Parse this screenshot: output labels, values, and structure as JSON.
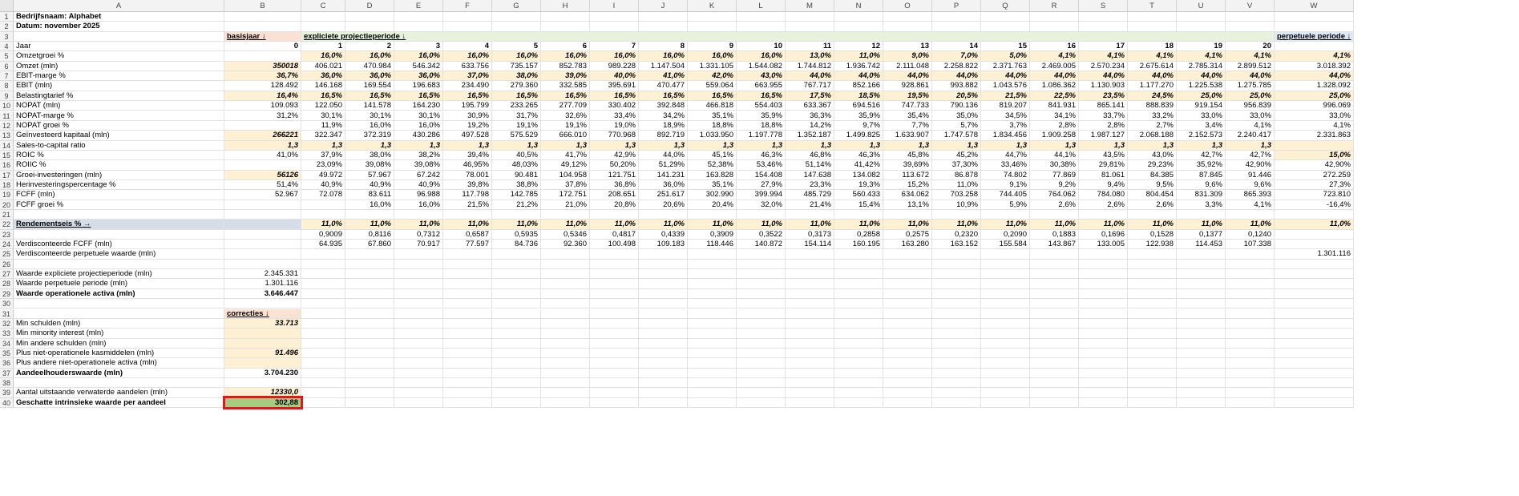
{
  "columns": [
    "A",
    "B",
    "C",
    "D",
    "E",
    "F",
    "G",
    "H",
    "I",
    "J",
    "K",
    "L",
    "M",
    "N",
    "O",
    "P",
    "Q",
    "R",
    "S",
    "T",
    "U",
    "V",
    "W"
  ],
  "row_numbers": [
    "1",
    "2",
    "3",
    "4",
    "5",
    "6",
    "7",
    "8",
    "9",
    "10",
    "11",
    "12",
    "13",
    "14",
    "15",
    "16",
    "17",
    "18",
    "19",
    "20",
    "21",
    "22",
    "23",
    "24",
    "25",
    "26",
    "27",
    "28",
    "29",
    "30",
    "31",
    "32",
    "33",
    "34",
    "35",
    "36",
    "37",
    "38",
    "39",
    "40"
  ],
  "header": {
    "company": "Bedrijfsnaam: Alphabet",
    "date": "Datum: november 2025",
    "base_year": "basisjaar ↓",
    "explicit_period": "expliciete projectieperiode ↓",
    "perpetual_period": "perpetuele periode ↓"
  },
  "rows": [
    {
      "row": 4,
      "label": "Jaar",
      "bold": false,
      "B": "0",
      "vals": [
        "1",
        "2",
        "3",
        "4",
        "5",
        "6",
        "7",
        "8",
        "9",
        "10",
        "11",
        "12",
        "13",
        "14",
        "15",
        "16",
        "17",
        "18",
        "19",
        "20"
      ],
      "W": "",
      "fmt": "b"
    },
    {
      "row": 5,
      "label": "Omzetgroei %",
      "B": "",
      "vals": [
        "16,0%",
        "16,0%",
        "16,0%",
        "16,0%",
        "16,0%",
        "16,0%",
        "16,0%",
        "16,0%",
        "16,0%",
        "16,0%",
        "13,0%",
        "11,0%",
        "9,0%",
        "7,0%",
        "5,0%",
        "4,1%",
        "4,1%",
        "4,1%",
        "4,1%",
        "4,1%"
      ],
      "W": "4,1%",
      "fmt": "yi"
    },
    {
      "row": 6,
      "label": "Omzet (mln)",
      "B": "350018",
      "vals": [
        "406.021",
        "470.984",
        "546.342",
        "633.756",
        "735.157",
        "852.783",
        "989.228",
        "1.147.504",
        "1.331.105",
        "1.544.082",
        "1.744.812",
        "1.936.742",
        "2.111.048",
        "2.258.822",
        "2.371.763",
        "2.469.005",
        "2.570.234",
        "2.675.614",
        "2.785.314",
        "2.899.512"
      ],
      "W": "3.018.392",
      "fmt": "n",
      "Bfmt": "yi"
    },
    {
      "row": 7,
      "label": "EBIT-marge %",
      "B": "36,7%",
      "vals": [
        "36,0%",
        "36,0%",
        "36,0%",
        "37,0%",
        "38,0%",
        "39,0%",
        "40,0%",
        "41,0%",
        "42,0%",
        "43,0%",
        "44,0%",
        "44,0%",
        "44,0%",
        "44,0%",
        "44,0%",
        "44,0%",
        "44,0%",
        "44,0%",
        "44,0%",
        "44,0%"
      ],
      "W": "44,0%",
      "fmt": "yi",
      "Bfmt": "yi"
    },
    {
      "row": 8,
      "label": "EBIT (mln)",
      "B": "128.492",
      "vals": [
        "146.168",
        "169.554",
        "196.683",
        "234.490",
        "279.360",
        "332.585",
        "395.691",
        "470.477",
        "559.064",
        "663.955",
        "767.717",
        "852.166",
        "928.861",
        "993.882",
        "1.043.576",
        "1.086.362",
        "1.130.903",
        "1.177.270",
        "1.225.538",
        "1.275.785"
      ],
      "W": "1.328.092",
      "fmt": "n"
    },
    {
      "row": 9,
      "label": "Belastingtarief %",
      "B": "16,4%",
      "vals": [
        "16,5%",
        "16,5%",
        "16,5%",
        "16,5%",
        "16,5%",
        "16,5%",
        "16,5%",
        "16,5%",
        "16,5%",
        "16,5%",
        "17,5%",
        "18,5%",
        "19,5%",
        "20,5%",
        "21,5%",
        "22,5%",
        "23,5%",
        "24,5%",
        "25,0%",
        "25,0%"
      ],
      "W": "25,0%",
      "fmt": "yi",
      "Bfmt": "yi"
    },
    {
      "row": 10,
      "label": "NOPAT (mln)",
      "B": "109.093",
      "vals": [
        "122.050",
        "141.578",
        "164.230",
        "195.799",
        "233.265",
        "277.709",
        "330.402",
        "392.848",
        "466.818",
        "554.403",
        "633.367",
        "694.516",
        "747.733",
        "790.136",
        "819.207",
        "841.931",
        "865.141",
        "888.839",
        "919.154",
        "956.839"
      ],
      "W": "996.069",
      "fmt": "n"
    },
    {
      "row": 11,
      "label": "NOPAT-marge %",
      "B": "31,2%",
      "vals": [
        "30,1%",
        "30,1%",
        "30,1%",
        "30,9%",
        "31,7%",
        "32,6%",
        "33,4%",
        "34,2%",
        "35,1%",
        "35,9%",
        "36,3%",
        "35,9%",
        "35,4%",
        "35,0%",
        "34,5%",
        "34,1%",
        "33,7%",
        "33,2%",
        "33,0%",
        "33,0%"
      ],
      "W": "33,0%",
      "fmt": "n"
    },
    {
      "row": 12,
      "label": "NOPAT groei %",
      "B": "",
      "vals": [
        "11,9%",
        "16,0%",
        "16,0%",
        "19,2%",
        "19,1%",
        "19,1%",
        "19,0%",
        "18,9%",
        "18,8%",
        "18,8%",
        "14,2%",
        "9,7%",
        "7,7%",
        "5,7%",
        "3,7%",
        "2,8%",
        "2,8%",
        "2,7%",
        "3,4%",
        "4,1%"
      ],
      "W": "4,1%",
      "fmt": "n"
    },
    {
      "row": 13,
      "label": "Geïnvesteerd kapitaal (mln)",
      "B": "266221",
      "vals": [
        "322.347",
        "372.319",
        "430.286",
        "497.528",
        "575.529",
        "666.010",
        "770.968",
        "892.719",
        "1.033.950",
        "1.197.778",
        "1.352.187",
        "1.499.825",
        "1.633.907",
        "1.747.578",
        "1.834.456",
        "1.909.258",
        "1.987.127",
        "2.068.188",
        "2.152.573",
        "2.240.417"
      ],
      "W": "2.331.863",
      "fmt": "n",
      "Bfmt": "yi"
    },
    {
      "row": 14,
      "label": "Sales-to-capital ratio",
      "B": "1,3",
      "vals": [
        "1,3",
        "1,3",
        "1,3",
        "1,3",
        "1,3",
        "1,3",
        "1,3",
        "1,3",
        "1,3",
        "1,3",
        "1,3",
        "1,3",
        "1,3",
        "1,3",
        "1,3",
        "1,3",
        "1,3",
        "1,3",
        "1,3",
        "1,3"
      ],
      "W": "",
      "fmt": "yi",
      "Bfmt": "yi"
    },
    {
      "row": 15,
      "label": "ROIC %",
      "B": "41,0%",
      "vals": [
        "37,9%",
        "38,0%",
        "38,2%",
        "39,4%",
        "40,5%",
        "41,7%",
        "42,9%",
        "44,0%",
        "45,1%",
        "46,3%",
        "46,8%",
        "46,3%",
        "45,8%",
        "45,2%",
        "44,7%",
        "44,1%",
        "43,5%",
        "43,0%",
        "42,7%",
        "42,7%"
      ],
      "W": "15,0%",
      "fmt": "n",
      "Wfmt": "yi"
    },
    {
      "row": 16,
      "label": "ROIIC %",
      "B": "",
      "vals": [
        "23,09%",
        "39,08%",
        "39,08%",
        "46,95%",
        "48,03%",
        "49,12%",
        "50,20%",
        "51,29%",
        "52,38%",
        "53,46%",
        "51,14%",
        "41,42%",
        "39,69%",
        "37,30%",
        "33,46%",
        "30,38%",
        "29,81%",
        "29,23%",
        "35,92%",
        "42,90%"
      ],
      "W": "42,90%",
      "fmt": "n"
    },
    {
      "row": 17,
      "label": "Groei-investeringen (mln)",
      "B": "56126",
      "vals": [
        "49.972",
        "57.967",
        "67.242",
        "78.001",
        "90.481",
        "104.958",
        "121.751",
        "141.231",
        "163.828",
        "154.408",
        "147.638",
        "134.082",
        "113.672",
        "86.878",
        "74.802",
        "77.869",
        "81.061",
        "84.385",
        "87.845",
        "91.446"
      ],
      "W": "272.259",
      "fmt": "n",
      "Bfmt": "yi"
    },
    {
      "row": 18,
      "label": "Herinvesteringspercentage %",
      "B": "51,4%",
      "vals": [
        "40,9%",
        "40,9%",
        "40,9%",
        "39,8%",
        "38,8%",
        "37,8%",
        "36,8%",
        "36,0%",
        "35,1%",
        "27,9%",
        "23,3%",
        "19,3%",
        "15,2%",
        "11,0%",
        "9,1%",
        "9,2%",
        "9,4%",
        "9,5%",
        "9,6%",
        "9,6%"
      ],
      "W": "27,3%",
      "fmt": "n"
    },
    {
      "row": 19,
      "label": "FCFF (mln)",
      "B": "52.967",
      "vals": [
        "72.078",
        "83.611",
        "96.988",
        "117.798",
        "142.785",
        "172.751",
        "208.651",
        "251.617",
        "302.990",
        "399.994",
        "485.729",
        "560.433",
        "634.062",
        "703.258",
        "744.405",
        "764.062",
        "784.080",
        "804.454",
        "831.309",
        "865.393"
      ],
      "W": "723.810",
      "fmt": "n"
    },
    {
      "row": 20,
      "label": "FCFF groei %",
      "B": "",
      "vals": [
        "",
        "16,0%",
        "16,0%",
        "21,5%",
        "21,2%",
        "21,0%",
        "20,8%",
        "20,6%",
        "20,4%",
        "32,0%",
        "21,4%",
        "15,4%",
        "13,1%",
        "10,9%",
        "5,9%",
        "2,6%",
        "2,6%",
        "2,6%",
        "3,3%",
        "4,1%"
      ],
      "W": "-16,4%",
      "fmt": "n"
    },
    {
      "row": 22,
      "label": "Rendementseis % →",
      "B": "",
      "vals": [
        "11,0%",
        "11,0%",
        "11,0%",
        "11,0%",
        "11,0%",
        "11,0%",
        "11,0%",
        "11,0%",
        "11,0%",
        "11,0%",
        "11,0%",
        "11,0%",
        "11,0%",
        "11,0%",
        "11,0%",
        "11,0%",
        "11,0%",
        "11,0%",
        "11,0%",
        "11,0%"
      ],
      "W": "11,0%",
      "fmt": "yi"
    },
    {
      "row": 23,
      "label": "",
      "B": "",
      "vals": [
        "0,9009",
        "0,8116",
        "0,7312",
        "0,6587",
        "0,5935",
        "0,5346",
        "0,4817",
        "0,4339",
        "0,3909",
        "0,3522",
        "0,3173",
        "0,2858",
        "0,2575",
        "0,2320",
        "0,2090",
        "0,1883",
        "0,1696",
        "0,1528",
        "0,1377",
        "0,1240"
      ],
      "W": "",
      "fmt": "n"
    },
    {
      "row": 24,
      "label": "Verdisconteerde FCFF (mln)",
      "B": "",
      "vals": [
        "64.935",
        "67.860",
        "70.917",
        "77.597",
        "84.736",
        "92.360",
        "100.498",
        "109.183",
        "118.446",
        "140.872",
        "154.114",
        "160.195",
        "163.280",
        "163.152",
        "155.584",
        "143.867",
        "133.005",
        "122.938",
        "114.453",
        "107.338"
      ],
      "W": "",
      "fmt": "n"
    },
    {
      "row": 25,
      "label": "Verdisconteerde perpetuele waarde (mln)",
      "B": "",
      "vals": [
        "",
        "",
        "",
        "",
        "",
        "",
        "",
        "",
        "",
        "",
        "",
        "",
        "",
        "",
        "",
        "",
        "",
        "",
        "",
        ""
      ],
      "W": "1.301.116",
      "fmt": "n"
    }
  ],
  "summary": [
    {
      "row": 27,
      "label": "Waarde expliciete projectieperiode (mln)",
      "B": "2.345.331"
    },
    {
      "row": 28,
      "label": "Waarde perpetuele periode (mln)",
      "B": "1.301.116"
    },
    {
      "row": 29,
      "label": "Waarde operationele activa (mln)",
      "B": "3.646.447",
      "bold": true
    }
  ],
  "corrections_header": "correcties ↓",
  "corrections": [
    {
      "row": 32,
      "label": "Min schulden (mln)",
      "B": "33.713"
    },
    {
      "row": 33,
      "label": "Min minority interest (mln)",
      "B": ""
    },
    {
      "row": 34,
      "label": "Min andere schulden (mln)",
      "B": ""
    },
    {
      "row": 35,
      "label": "Plus niet-operationele kasmiddelen (mln)",
      "B": "91.496"
    },
    {
      "row": 36,
      "label": "Plus andere niet-operationele activa (mln)",
      "B": ""
    }
  ],
  "equity": {
    "label": "Aandeelhouderswaarde (mln)",
    "B": "3.704.230"
  },
  "shares": {
    "label": "Aantal uitstaande verwaterde aandelen (mln)",
    "B": "12330,0"
  },
  "intrinsic": {
    "label": "Geschatte intrinsieke waarde per aandeel",
    "B": "302,88"
  },
  "colors": {
    "yellow": "#fdf0d3",
    "peach": "#fbe1d3",
    "green": "#e6f2dc",
    "blue": "#dde9f5",
    "result_green": "#a5cc7f",
    "highlight_red": "#e8141b"
  }
}
